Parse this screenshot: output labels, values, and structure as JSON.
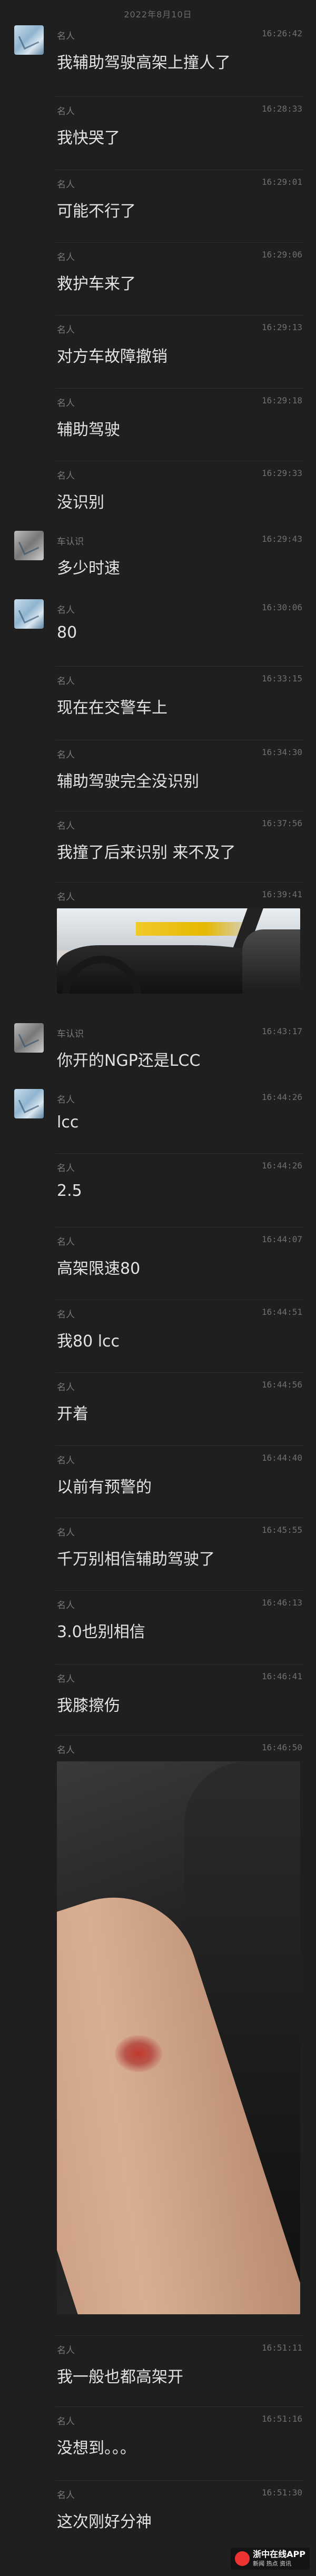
{
  "header": {
    "date": "2022年8月10日"
  },
  "messages": [
    {
      "name": "名人",
      "time": "16:26:42",
      "text": "我辅助驾驶高架上撞人了"
    },
    {
      "name": "名人",
      "time": "16:28:33",
      "text": "我快哭了"
    },
    {
      "name": "名人",
      "time": "16:29:01",
      "text": "可能不行了"
    },
    {
      "name": "名人",
      "time": "16:29:06",
      "text": "救护车来了"
    },
    {
      "name": "名人",
      "time": "16:29:13",
      "text": "对方车故障撤销"
    },
    {
      "name": "名人",
      "time": "16:29:18",
      "text": "辅助驾驶"
    },
    {
      "name": "名人",
      "time": "16:29:33",
      "text": "没识别"
    },
    {
      "name": "车认识",
      "time": "16:29:43",
      "text": "多少时速"
    },
    {
      "name": "名人",
      "time": "16:30:06",
      "text": "80"
    },
    {
      "name": "名人",
      "time": "16:33:15",
      "text": "现在在交警车上"
    },
    {
      "name": "名人",
      "time": "16:34:30",
      "text": "辅助驾驶完全没识别"
    },
    {
      "name": "名人",
      "time": "16:37:56",
      "text": "我撞了后来识别 来不及了"
    },
    {
      "name": "名人",
      "time": "16:39:41",
      "image": "car-interior-photo"
    },
    {
      "name": "车认识",
      "time": "16:43:17",
      "text": "你开的NGP还是LCC"
    },
    {
      "name": "名人",
      "time": "16:44:26",
      "text": "lcc"
    },
    {
      "name": "名人",
      "time": "16:44:26",
      "text": "2.5"
    },
    {
      "name": "名人",
      "time": "16:44:07",
      "text": "高架限速80"
    },
    {
      "name": "名人",
      "time": "16:44:51",
      "text": "我80 lcc"
    },
    {
      "name": "名人",
      "time": "16:44:56",
      "text": "开着"
    },
    {
      "name": "名人",
      "time": "16:44:40",
      "text": "以前有预警的"
    },
    {
      "name": "名人",
      "time": "16:45:55",
      "text": "千万别相信辅助驾驶了"
    },
    {
      "name": "名人",
      "time": "16:46:13",
      "text": "3.0也别相信"
    },
    {
      "name": "名人",
      "time": "16:46:41",
      "text": "我膝擦伤"
    },
    {
      "name": "名人",
      "time": "16:46:50",
      "image": "arm-injury-photo"
    },
    {
      "name": "名人",
      "time": "16:51:11",
      "text": "我一般也都高架开"
    },
    {
      "name": "名人",
      "time": "16:51:16",
      "text": "没想到。。。"
    },
    {
      "name": "名人",
      "time": "16:51:30",
      "text": "这次刚好分神"
    }
  ],
  "watermark": {
    "title": "浙中在线APP",
    "subtitle": "新闻 热点 资讯"
  },
  "colors": {
    "background": "#1f1f1f",
    "text": "#e3e3e3",
    "meta": "#7a7a7a"
  }
}
